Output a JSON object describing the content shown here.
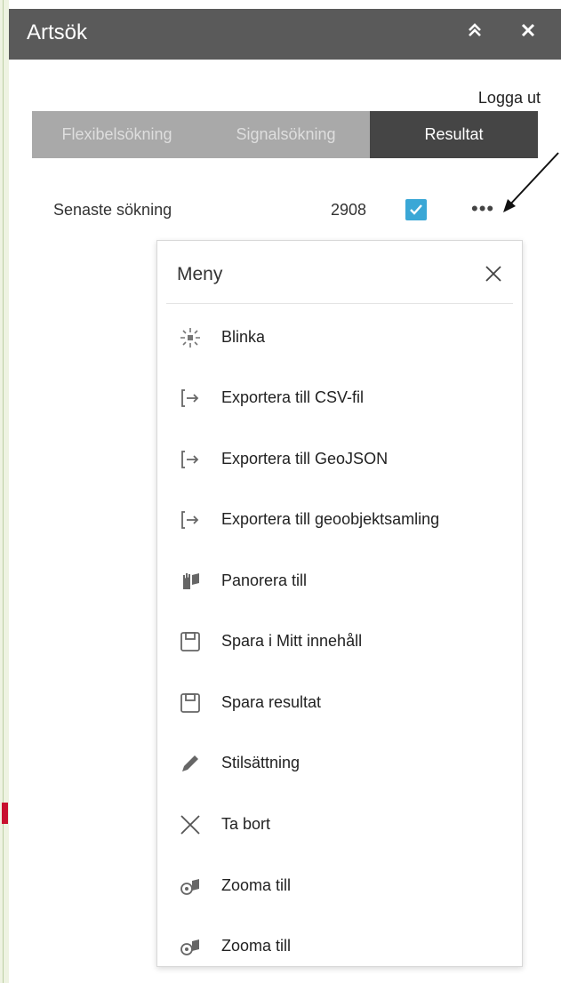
{
  "header": {
    "title": "Artsök",
    "collapse_icon": "double-chevron-up-icon",
    "close_icon": "close-icon"
  },
  "logout_label": "Logga ut",
  "tabs": [
    {
      "label": "Flexibelsökning",
      "active": false
    },
    {
      "label": "Signalsökning",
      "active": false
    },
    {
      "label": "Resultat",
      "active": true
    }
  ],
  "result": {
    "label": "Senaste sökning",
    "count": "2908",
    "visible_checked": true,
    "more_label": "•••"
  },
  "menu": {
    "title": "Meny",
    "items": [
      {
        "label": "Blinka",
        "icon": "flash-icon"
      },
      {
        "label": "Exportera till CSV-fil",
        "icon": "export-icon"
      },
      {
        "label": "Exportera till GeoJSON",
        "icon": "export-icon"
      },
      {
        "label": "Exportera till geoobjektsamling",
        "icon": "export-icon"
      },
      {
        "label": "Panorera till",
        "icon": "pan-icon"
      },
      {
        "label": "Spara i Mitt innehåll",
        "icon": "save-icon"
      },
      {
        "label": "Spara resultat",
        "icon": "save-icon"
      },
      {
        "label": "Stilsättning",
        "icon": "pencil-icon"
      },
      {
        "label": "Ta bort",
        "icon": "delete-icon"
      },
      {
        "label": "Zooma till",
        "icon": "zoom-to-icon"
      },
      {
        "label": "Zooma till",
        "icon": "zoom-to-icon"
      }
    ]
  },
  "colors": {
    "header_bg": "#5a5a5a",
    "tab_active": "#454545",
    "tab_inactive": "#a9a9a9",
    "checkbox": "#3aa7d6"
  }
}
